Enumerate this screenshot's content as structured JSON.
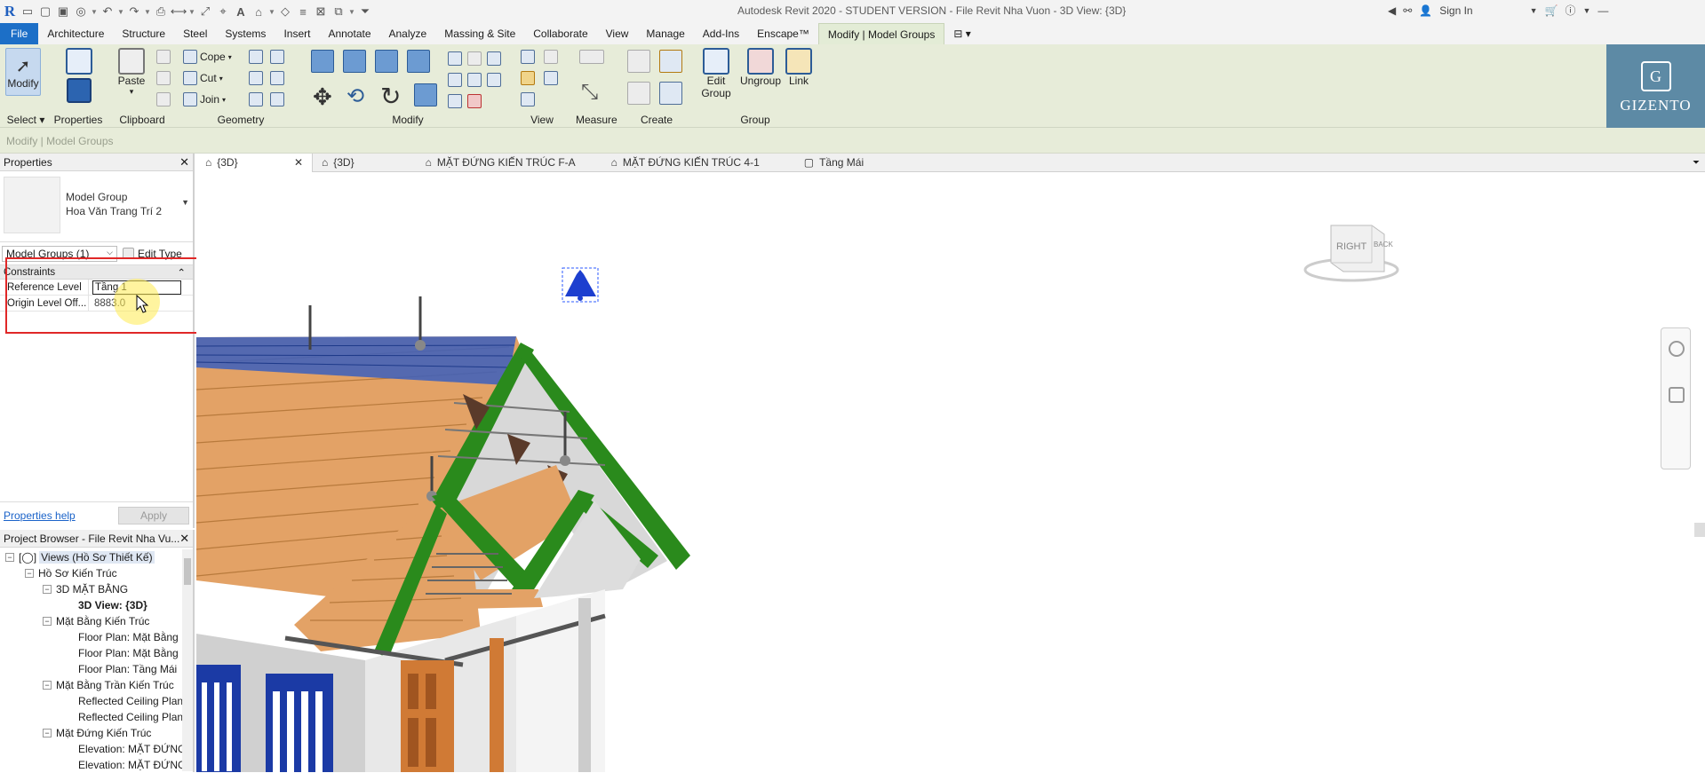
{
  "title": "Autodesk Revit 2020 - STUDENT VERSION - File Revit Nha Vuon - 3D View: {3D}",
  "signin": "Sign In",
  "ribbon_tabs": [
    "File",
    "Architecture",
    "Structure",
    "Steel",
    "Systems",
    "Insert",
    "Annotate",
    "Analyze",
    "Massing & Site",
    "Collaborate",
    "View",
    "Manage",
    "Add-Ins",
    "Enscape™",
    "Modify | Model Groups"
  ],
  "ribbon": {
    "modify_label": "Modify",
    "select_label": "Select",
    "properties_label": "Properties",
    "paste_label": "Paste",
    "clipboard_label": "Clipboard",
    "cope_label": "Cope",
    "cut_label": "Cut",
    "join_label": "Join",
    "geometry_label": "Geometry",
    "modify_panel_label": "Modify",
    "view_label": "View",
    "measure_label": "Measure",
    "create_label": "Create",
    "edit_group_label": "Edit Group",
    "ungroup_label": "Ungroup",
    "link_label": "Link",
    "group_label": "Group"
  },
  "context_text": "Modify | Model Groups",
  "brand": {
    "mark": "G",
    "name": "GIZENTO"
  },
  "properties": {
    "header": "Properties",
    "type_line1": "Model Group",
    "type_line2": "Hoa Văn Trang Trí 2",
    "selector": "Model Groups (1)",
    "edit_type": "Edit Type",
    "group_name": "Constraints",
    "rows": [
      {
        "key": "Reference Level",
        "value": "Tầng 1"
      },
      {
        "key": "Origin Level Off...",
        "value": "8883.0"
      }
    ],
    "help": "Properties help",
    "apply": "Apply"
  },
  "project_browser": {
    "header": "Project Browser - File Revit Nha Vu...",
    "nodes": [
      {
        "label": "Views (Hồ Sơ Thiết Kế)",
        "toggle": "−"
      },
      {
        "label": "Hồ Sơ Kiến Trúc",
        "toggle": "−"
      },
      {
        "label": "3D MẶT BẰNG",
        "toggle": "−"
      },
      {
        "label": "3D View: {3D}",
        "toggle": ""
      },
      {
        "label": "Mặt Bằng Kiến Trúc",
        "toggle": "−"
      },
      {
        "label": "Floor Plan: Mặt Bằng",
        "toggle": ""
      },
      {
        "label": "Floor Plan: Mặt Bằng",
        "toggle": ""
      },
      {
        "label": "Floor Plan: Tầng Mái",
        "toggle": ""
      },
      {
        "label": "Mặt Bằng Trần Kiến Trúc",
        "toggle": "−"
      },
      {
        "label": "Reflected Ceiling Plan",
        "toggle": ""
      },
      {
        "label": "Reflected Ceiling Plan",
        "toggle": ""
      },
      {
        "label": "Mặt Đứng Kiến Trúc",
        "toggle": "−"
      },
      {
        "label": "Elevation: MẶT ĐỨNG",
        "toggle": ""
      },
      {
        "label": "Elevation: MẶT ĐỨNG",
        "toggle": ""
      }
    ]
  },
  "view_tabs": [
    "{3D}",
    "{3D}",
    "MẶT ĐỨNG KIẾN TRÚC F-A",
    "MẶT ĐỨNG KIẾN TRÚC 4-1",
    "Tầng Mái"
  ],
  "viewcube": {
    "right": "RIGHT",
    "back": "BACK"
  },
  "colors": {
    "file_tab": "#1c6fc7",
    "ribbon_bg": "#e7ecd9",
    "selection": "#e02828",
    "roof_tile": "#e3a266",
    "trim": "#2a8a1c"
  }
}
